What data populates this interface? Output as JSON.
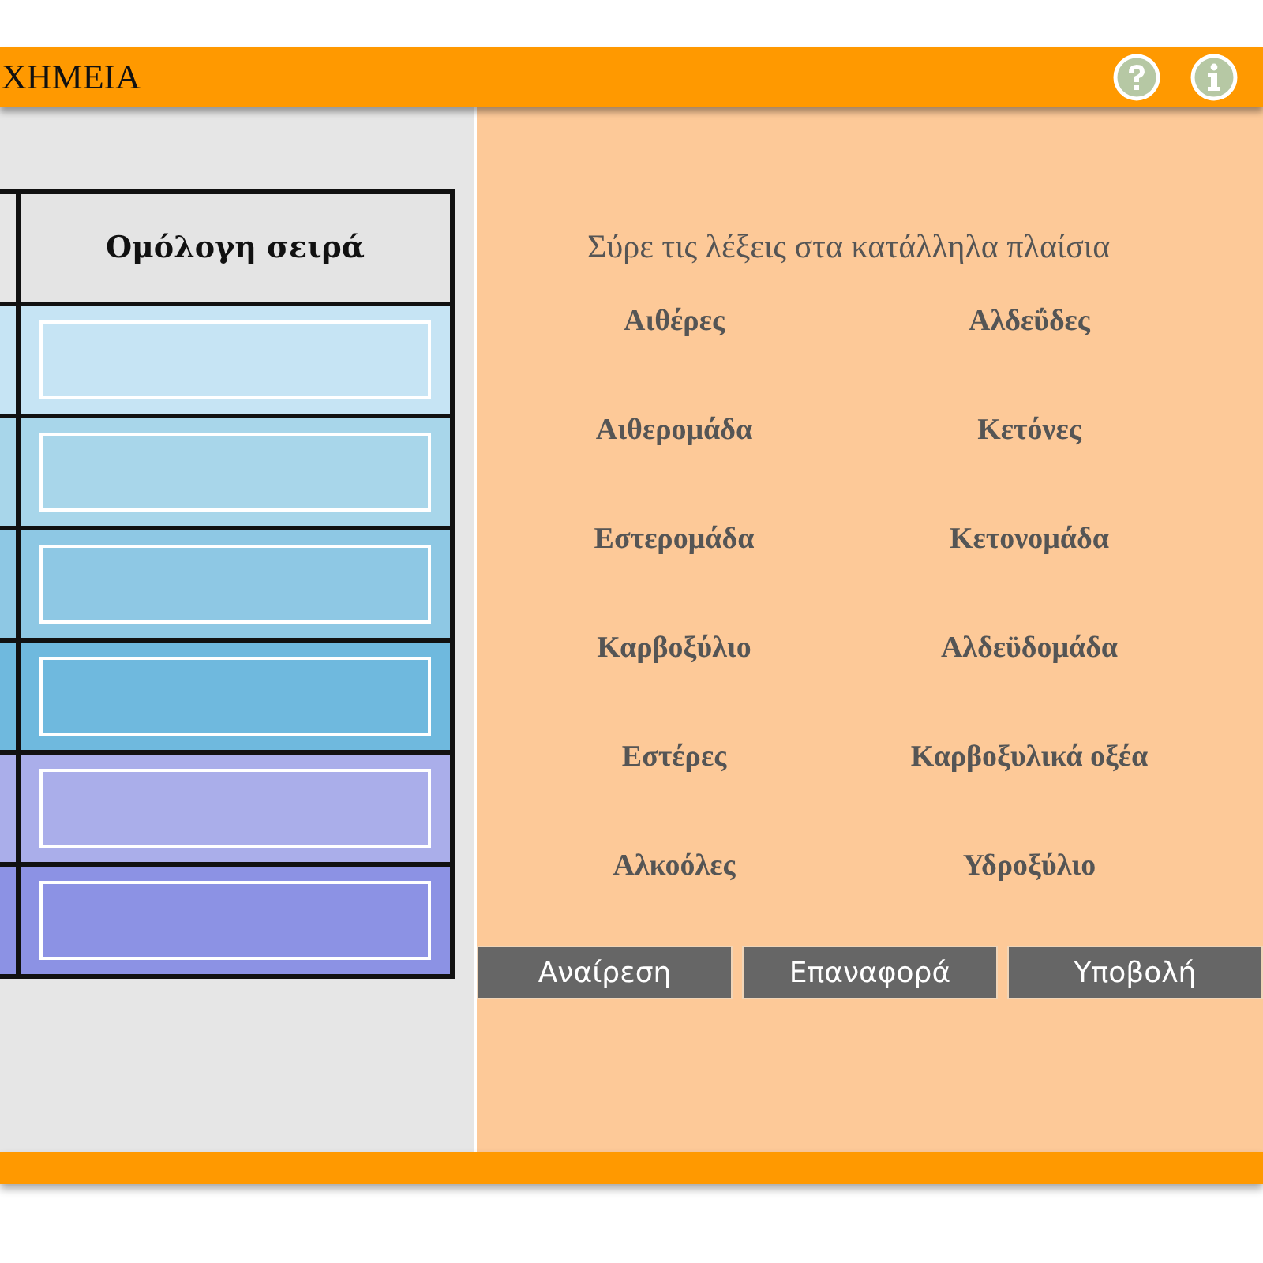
{
  "header": {
    "title": "ΧΗΜΕΙΑ",
    "icons": [
      {
        "kind": "help"
      },
      {
        "kind": "info"
      }
    ]
  },
  "table": {
    "column_2": "Ομόλογη σειρά",
    "rows": [
      {
        "color": "#c6e4f4"
      },
      {
        "color": "#a8d6ea"
      },
      {
        "color": "#8ec8e4"
      },
      {
        "color": "#6fb9de"
      },
      {
        "color": "#aaaeea"
      },
      {
        "color": "#8c92e4"
      }
    ]
  },
  "panel": {
    "instruction": "Σύρε τις λέξεις στα κατάλληλα πλαίσια",
    "words": [
      "Αιθέρες",
      "Αλδεΰδες",
      "Αιθερομάδα",
      "Κετόνες",
      "Εστερομάδα",
      "Κετονομάδα",
      "Καρβοξύλιο",
      "Αλδεϋδομάδα",
      "Εστέρες",
      "Καρβοξυλικά οξέα",
      "Αλκοόλες",
      "Υδροξύλιο"
    ],
    "buttons": [
      "Αναίρεση",
      "Επαναφορά",
      "Υποβολή"
    ]
  }
}
